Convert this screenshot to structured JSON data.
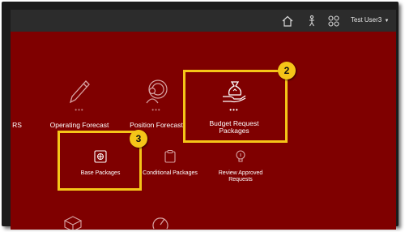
{
  "header": {
    "user_label": "Test User3",
    "caret": "▼",
    "icons": [
      "home-icon",
      "navigator-icon",
      "apps-grid-icon"
    ]
  },
  "row1": {
    "rs_fragment": "RS",
    "operating_forecast": "Operating Forecast",
    "position_forecast": "Position Forecast",
    "budget_request_line1": "Budget Request",
    "budget_request_line2": "Packages",
    "dots": "•••"
  },
  "row2": {
    "base_packages": "Base Packages",
    "conditional_packages": "Conditional Packages",
    "review_approved_line1": "Review Approved",
    "review_approved_line2": "Requests"
  },
  "callouts": {
    "step2": "2",
    "step3": "3",
    "color": "#f5c518"
  },
  "colors": {
    "background": "#7f0000",
    "topbar": "#2c2c2c"
  }
}
